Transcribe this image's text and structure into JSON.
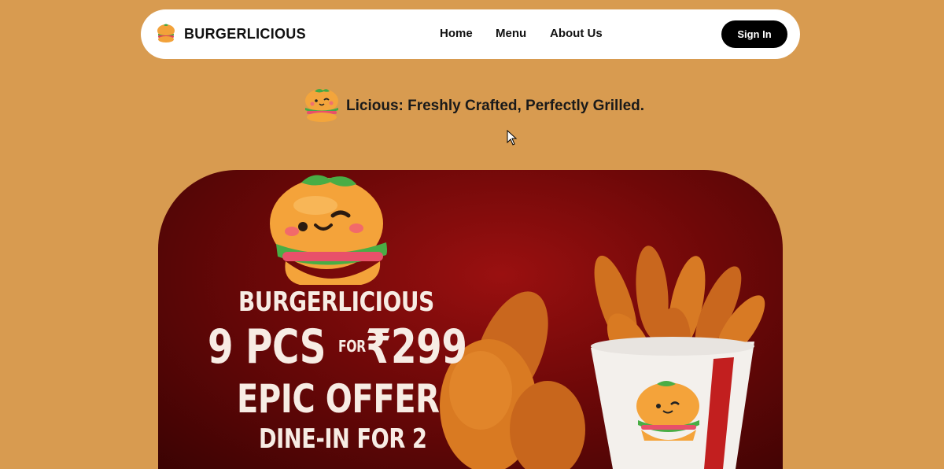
{
  "navbar": {
    "brand": "BURGERLICIOUS",
    "links": [
      "Home",
      "Menu",
      "About Us"
    ],
    "signin_label": "Sign In"
  },
  "tagline": "Licious: Freshly Crafted, Perfectly Grilled.",
  "hero": {
    "promo": {
      "line1": "BURGERLICIOUS",
      "line2_count": "9 PCS",
      "line2_for": "FOR",
      "line2_price": "₹299",
      "line3": "EPIC OFFER",
      "line4": "DINE-IN FOR 2"
    },
    "icons": [
      "burger-mascot-icon",
      "chicken-bucket-image",
      "chevron-left-icon",
      "chevron-right-icon"
    ]
  },
  "colors": {
    "page_background": "#D89B50",
    "navbar_background": "#FFFFFF",
    "signin_background": "#000000",
    "hero_background": "#7A0A0A",
    "promo_text": "#F7ECE4"
  }
}
